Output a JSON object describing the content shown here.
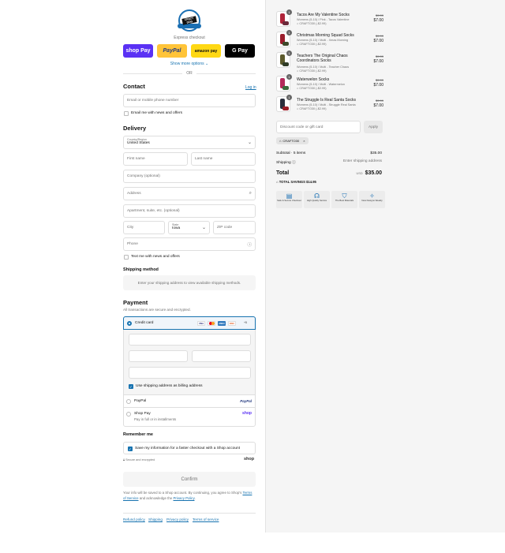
{
  "brand": {
    "logo_text": "CRAZY DOG"
  },
  "express": {
    "label": "Express checkout",
    "shop_pay": "shop Pay",
    "paypal": "PayPal",
    "amazon": "amazon pay",
    "gpay": "G Pay",
    "show_more": "Show more options",
    "or": "OR"
  },
  "contact": {
    "title": "Contact",
    "login": "Log in",
    "email_placeholder": "Email or mobile phone number",
    "news_label": "Email me with news and offers"
  },
  "delivery": {
    "title": "Delivery",
    "country_label": "Country/Region",
    "country_value": "United States",
    "first_name": "First name",
    "last_name": "Last name",
    "company": "Company (optional)",
    "address": "Address",
    "apartment": "Apartment, suite, etc. (optional)",
    "city": "City",
    "state_label": "State",
    "state_value": "Iowa",
    "zip": "ZIP code",
    "phone": "Phone",
    "text_label": "Text me with news and offers"
  },
  "shipping_method": {
    "title": "Shipping method",
    "note": "Enter your shipping address to view available shipping methods."
  },
  "payment": {
    "title": "Payment",
    "subtitle": "All transactions are secure and encrypted.",
    "credit_card": "Credit card",
    "card_brands": [
      "VISA",
      "MC",
      "AMEX",
      "DISC",
      "+5"
    ],
    "billing_same": "Use shipping address as billing address",
    "paypal": "PayPal",
    "paypal_logo": "PayPal",
    "shop_pay": "Shop Pay",
    "shop_pay_sub": "Pay in full or in installments",
    "shop_logo": "shop"
  },
  "remember": {
    "title": "Remember me",
    "save_label": "Save my information for a faster checkout with a Shop account",
    "secure": "Secure and encrypted",
    "shop_logo": "shop"
  },
  "confirm": {
    "button": "Confirm",
    "legal_1": "Your info will be saved to a Shop account. By continuing, you agree to Shop's",
    "terms": "Terms of Service",
    "legal_2": "and acknowledge the",
    "privacy": "Privacy Policy"
  },
  "footer": [
    "Refund policy",
    "Shipping",
    "Privacy policy",
    "Terms of service"
  ],
  "cart": {
    "items": [
      {
        "qty": "1",
        "title": "Tacos Are My Valentine Socks",
        "variant": "Womens (5-10) / Pink - Tacos Valentine",
        "discount": "CRAFTO30 (-$2.99)",
        "old_price": "$9.99",
        "price": "$7.00",
        "colors": [
          "#b0243a",
          "#6b2a3a"
        ]
      },
      {
        "qty": "1",
        "title": "Christmas Morning Squad Socks",
        "variant": "Womens (5-10) / Multi - Xmas Morning",
        "discount": "CRAFTO30 (-$2.99)",
        "old_price": "$9.99",
        "price": "$7.00",
        "colors": [
          "#9b1d2c",
          "#3c4a2a"
        ]
      },
      {
        "qty": "1",
        "title": "Teachers The Original Chaos Coordinators Socks",
        "variant": "Womens (5-10) / Multi - Teacher Chaos",
        "discount": "CRAFTO30 (-$2.99)",
        "old_price": "$9.99",
        "price": "$7.00",
        "colors": [
          "#5c5a2c",
          "#2f3b26"
        ]
      },
      {
        "qty": "1",
        "title": "Waterwelon Socks",
        "variant": "Womens (5-10) / Multi - Watermelon",
        "discount": "CRAFTO30 (-$2.99)",
        "old_price": "$9.99",
        "price": "$7.00",
        "colors": [
          "#b42a5a",
          "#3a6a3a"
        ]
      },
      {
        "qty": "1",
        "title": "The Struggle Is Real Santa Socks",
        "variant": "Womens (5-10) / Multi - Struggle Real Santa",
        "discount": "CRAFTO30 (-$2.99)",
        "old_price": "$9.99",
        "price": "$7.00",
        "colors": [
          "#2a2f3c",
          "#9a1c26"
        ]
      }
    ],
    "discount_placeholder": "Discount code or gift card",
    "apply": "Apply",
    "code_tag": "CRAFTO30",
    "subtotal_label": "Subtotal · 5 items",
    "subtotal_value": "$35.00",
    "shipping_label": "Shipping",
    "shipping_value": "Enter shipping address",
    "total_label": "Total",
    "currency": "USD",
    "total_value": "$35.00",
    "savings": "TOTAL SAVINGS  $14.95",
    "badges": [
      {
        "icon": "lock",
        "text": "Safe & Secure Checkout"
      },
      {
        "icon": "headset",
        "text": "High Quality Service"
      },
      {
        "icon": "shirt",
        "text": "The Best Materials"
      },
      {
        "icon": "star",
        "text": "New Designs Weekly"
      }
    ]
  }
}
